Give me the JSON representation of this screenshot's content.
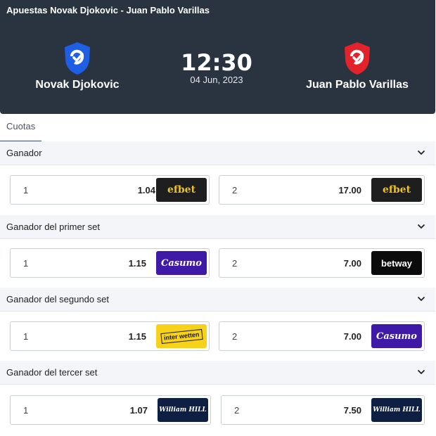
{
  "header": {
    "title": "Apuestas Novak Djokovic - Juan Pablo Varillas",
    "home_team": {
      "name": "Novak Djokovic",
      "shield_color": "#1f5fe6"
    },
    "away_team": {
      "name": "Juan Pablo Varillas",
      "shield_color": "#e3232b"
    },
    "time": "12:30",
    "date": "04 Jun, 2023"
  },
  "tabs": [
    {
      "label": "Cuotas",
      "active": true
    }
  ],
  "markets": [
    {
      "title": "Ganador",
      "odds": [
        {
          "selection": "1",
          "value": "1.04",
          "bookmaker": "efbet"
        },
        {
          "selection": "2",
          "value": "17.00",
          "bookmaker": "efbet"
        }
      ]
    },
    {
      "title": "Ganador del primer set",
      "odds": [
        {
          "selection": "1",
          "value": "1.15",
          "bookmaker": "Casumo"
        },
        {
          "selection": "2",
          "value": "7.00",
          "bookmaker": "betway"
        }
      ]
    },
    {
      "title": "Ganador del segundo set",
      "odds": [
        {
          "selection": "1",
          "value": "1.15",
          "bookmaker": "inter wetten"
        },
        {
          "selection": "2",
          "value": "7.00",
          "bookmaker": "Casumo"
        }
      ]
    },
    {
      "title": "Ganador del tercer set",
      "odds": [
        {
          "selection": "1",
          "value": "1.07",
          "bookmaker": "William HILL"
        },
        {
          "selection": "2",
          "value": "7.50",
          "bookmaker": "William HILL"
        }
      ]
    }
  ],
  "icons": {
    "shield": "shield-check-icon",
    "chevron": "chevron-down-icon"
  }
}
